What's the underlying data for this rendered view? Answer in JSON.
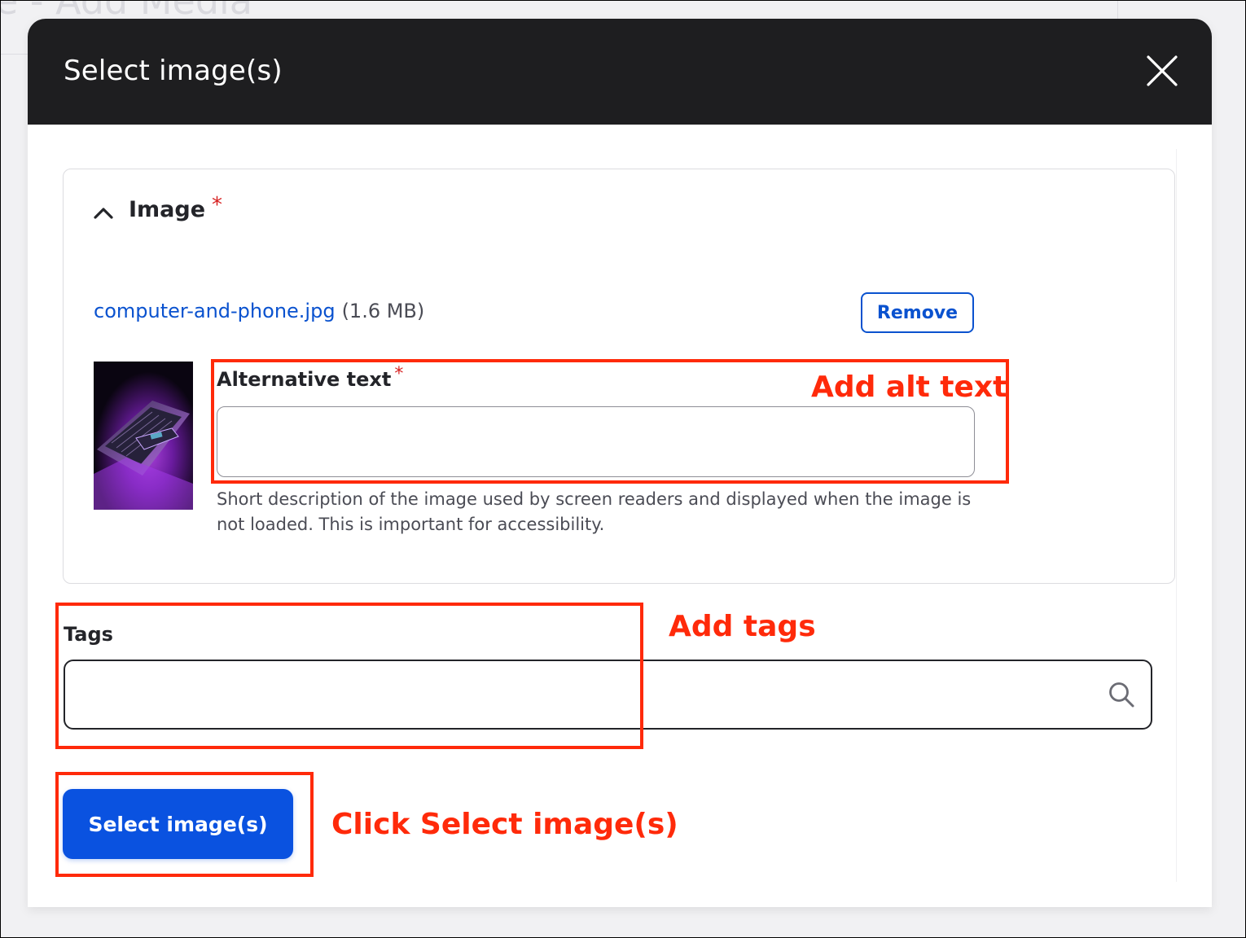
{
  "background": {
    "page_title_fragment": "e - Add Media"
  },
  "dialog": {
    "title": "Select image(s)",
    "close_icon": "close-icon"
  },
  "image_section": {
    "title": "Image",
    "required_marker": "*",
    "toggle_icon": "chevron-up-icon",
    "file": {
      "name": "computer-and-phone.jpg",
      "size": "(1.6 MB)"
    },
    "remove_label": "Remove",
    "alt_text": {
      "label": "Alternative text",
      "required_marker": "*",
      "value": "",
      "description": "Short description of the image used by screen readers and displayed when the image is not loaded. This is important for accessibility."
    }
  },
  "tags": {
    "label": "Tags",
    "value": "",
    "search_icon": "search-icon"
  },
  "submit_label": "Select image(s)",
  "annotations": {
    "alt": "Add alt text",
    "tags": "Add tags",
    "select": "Click Select image(s)"
  },
  "colors": {
    "header_bg": "#1e1e20",
    "link": "#0a52cf",
    "primary_button": "#0a52e0",
    "required": "#d72222",
    "annotation": "#ff2a0a"
  }
}
